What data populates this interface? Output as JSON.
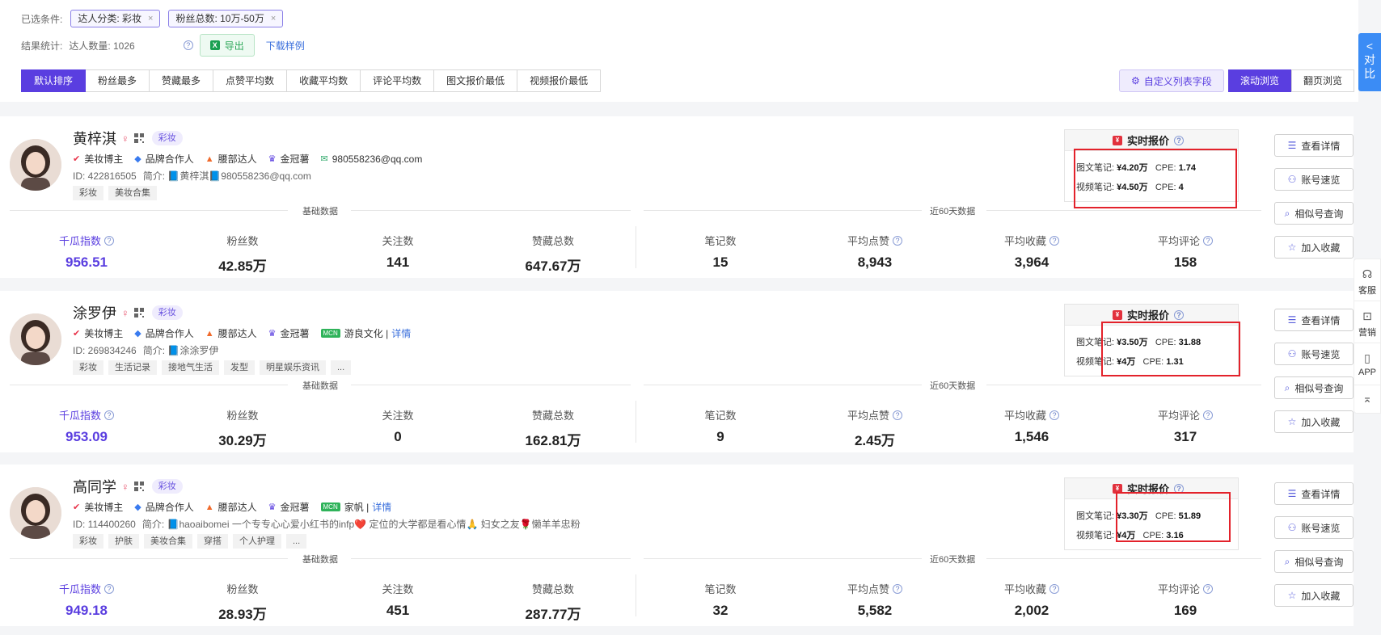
{
  "filters": {
    "label": "已选条件:",
    "chips": [
      {
        "text": "达人分类: 彩妆"
      },
      {
        "text": "粉丝总数: 10万-50万"
      }
    ],
    "close_glyph": "×"
  },
  "stats": {
    "label": "结果统计:",
    "count_text": "达人数量: 1026",
    "export_label": "导出",
    "sample_link": "下载样例"
  },
  "sort_tabs": [
    {
      "label": "默认排序",
      "active": true
    },
    {
      "label": "粉丝最多"
    },
    {
      "label": "赞藏最多"
    },
    {
      "label": "点赞平均数"
    },
    {
      "label": "收藏平均数"
    },
    {
      "label": "评论平均数"
    },
    {
      "label": "图文报价最低"
    },
    {
      "label": "视频报价最低"
    }
  ],
  "custom_fields_label": "自定义列表字段",
  "view_modes": [
    {
      "label": "滚动浏览",
      "active": true
    },
    {
      "label": "翻页浏览"
    }
  ],
  "compare_tab": {
    "arrow": "<",
    "label": "对比"
  },
  "side_tools": [
    {
      "icon": "headset-icon",
      "glyph": "☊",
      "label": "客服"
    },
    {
      "icon": "chart-icon",
      "glyph": "⊡",
      "label": "营销"
    },
    {
      "icon": "phone-icon",
      "glyph": "▯",
      "label": "APP"
    },
    {
      "icon": "back-to-top-icon",
      "glyph": "⌅",
      "label": ""
    }
  ],
  "section_labels": {
    "basic": "基础数据",
    "recent": "近60天数据"
  },
  "quote_title": "实时报价",
  "actions": [
    {
      "label": "查看详情",
      "glyph": "☰"
    },
    {
      "label": "账号速览",
      "glyph": "⚇"
    },
    {
      "label": "相似号查询",
      "glyph": "⌕"
    },
    {
      "label": "加入收藏",
      "glyph": "☆"
    }
  ],
  "influencers": [
    {
      "name": "黄梓淇",
      "category": "彩妆",
      "tags": [
        {
          "icon": "check-circle-icon",
          "color": "#e8334a",
          "glyph": "✔",
          "text": "美妆博主"
        },
        {
          "icon": "diamond-icon",
          "color": "#3a7bef",
          "glyph": "◆",
          "text": "品牌合作人"
        },
        {
          "icon": "person-icon",
          "color": "#f06a2b",
          "glyph": "▲",
          "text": "腰部达人"
        },
        {
          "icon": "crown-icon",
          "color": "#5a3ee0",
          "glyph": "♛",
          "text": "金冠薯"
        },
        {
          "icon": "mail-icon",
          "color": "#2fa96a",
          "glyph": "✉",
          "text": "980558236@qq.com"
        }
      ],
      "mcn": null,
      "id_text": "ID: 422816505",
      "bio": "简介: 📘黄梓淇📘980558236@qq.com",
      "chips": [
        "彩妆",
        "美妆合集"
      ],
      "metrics": {
        "qiangua_label": "千瓜指数",
        "qiangua": "956.51",
        "fans_label": "粉丝数",
        "fans": "42.85万",
        "follow_label": "关注数",
        "follow": "141",
        "likes_label": "赞藏总数",
        "likes": "647.67万",
        "notes_label": "笔记数",
        "notes": "15",
        "avg_like_label": "平均点赞",
        "avg_like": "8,943",
        "avg_fav_label": "平均收藏",
        "avg_fav": "3,964",
        "avg_cmt_label": "平均评论",
        "avg_cmt": "158"
      },
      "quote": {
        "image_label": "图文笔记:",
        "image_price": "¥4.20万",
        "image_cpe_label": "CPE:",
        "image_cpe": "1.74",
        "video_label": "视频笔记:",
        "video_price": "¥4.50万",
        "video_cpe_label": "CPE:",
        "video_cpe": "4"
      }
    },
    {
      "name": "涂罗伊",
      "category": "彩妆",
      "tags": [
        {
          "icon": "check-circle-icon",
          "color": "#e8334a",
          "glyph": "✔",
          "text": "美妆博主"
        },
        {
          "icon": "diamond-icon",
          "color": "#3a7bef",
          "glyph": "◆",
          "text": "品牌合作人"
        },
        {
          "icon": "person-icon",
          "color": "#f06a2b",
          "glyph": "▲",
          "text": "腰部达人"
        },
        {
          "icon": "crown-icon",
          "color": "#5a3ee0",
          "glyph": "♛",
          "text": "金冠薯"
        }
      ],
      "mcn": {
        "badge": "MCN",
        "name": "游良文化 |",
        "link": "详情"
      },
      "id_text": "ID: 269834246",
      "bio": "简介: 📘涂涂罗伊",
      "chips": [
        "彩妆",
        "生活记录",
        "接地气生活",
        "发型",
        "明星娱乐资讯",
        "..."
      ],
      "metrics": {
        "qiangua_label": "千瓜指数",
        "qiangua": "953.09",
        "fans_label": "粉丝数",
        "fans": "30.29万",
        "follow_label": "关注数",
        "follow": "0",
        "likes_label": "赞藏总数",
        "likes": "162.81万",
        "notes_label": "笔记数",
        "notes": "9",
        "avg_like_label": "平均点赞",
        "avg_like": "2.45万",
        "avg_fav_label": "平均收藏",
        "avg_fav": "1,546",
        "avg_cmt_label": "平均评论",
        "avg_cmt": "317"
      },
      "quote": {
        "image_label": "图文笔记:",
        "image_price": "¥3.50万",
        "image_cpe_label": "CPE:",
        "image_cpe": "31.88",
        "video_label": "视频笔记:",
        "video_price": "¥4万",
        "video_cpe_label": "CPE:",
        "video_cpe": "1.31"
      }
    },
    {
      "name": "高同学",
      "category": "彩妆",
      "tags": [
        {
          "icon": "check-circle-icon",
          "color": "#e8334a",
          "glyph": "✔",
          "text": "美妆博主"
        },
        {
          "icon": "diamond-icon",
          "color": "#3a7bef",
          "glyph": "◆",
          "text": "品牌合作人"
        },
        {
          "icon": "person-icon",
          "color": "#f06a2b",
          "glyph": "▲",
          "text": "腰部达人"
        },
        {
          "icon": "crown-icon",
          "color": "#5a3ee0",
          "glyph": "♛",
          "text": "金冠薯"
        }
      ],
      "mcn": {
        "badge": "MCN",
        "name": "家帆 |",
        "link": "详情"
      },
      "id_text": "ID: 114400260",
      "bio": "简介: 📘haoaibomei 一个专专心心爱小红书的infp❤️ 定位的大学都是看心情🙏 妇女之友🌹懒羊羊忠粉",
      "chips": [
        "彩妆",
        "护肤",
        "美妆合集",
        "穿搭",
        "个人护理",
        "..."
      ],
      "metrics": {
        "qiangua_label": "千瓜指数",
        "qiangua": "949.18",
        "fans_label": "粉丝数",
        "fans": "28.93万",
        "follow_label": "关注数",
        "follow": "451",
        "likes_label": "赞藏总数",
        "likes": "287.77万",
        "notes_label": "笔记数",
        "notes": "32",
        "avg_like_label": "平均点赞",
        "avg_like": "5,582",
        "avg_fav_label": "平均收藏",
        "avg_fav": "2,002",
        "avg_cmt_label": "平均评论",
        "avg_cmt": "169"
      },
      "quote": {
        "image_label": "图文笔记:",
        "image_price": "¥3.30万",
        "image_cpe_label": "CPE:",
        "image_cpe": "51.89",
        "video_label": "视频笔记:",
        "video_price": "¥4万",
        "video_cpe_label": "CPE:",
        "video_cpe": "3.16"
      }
    }
  ]
}
